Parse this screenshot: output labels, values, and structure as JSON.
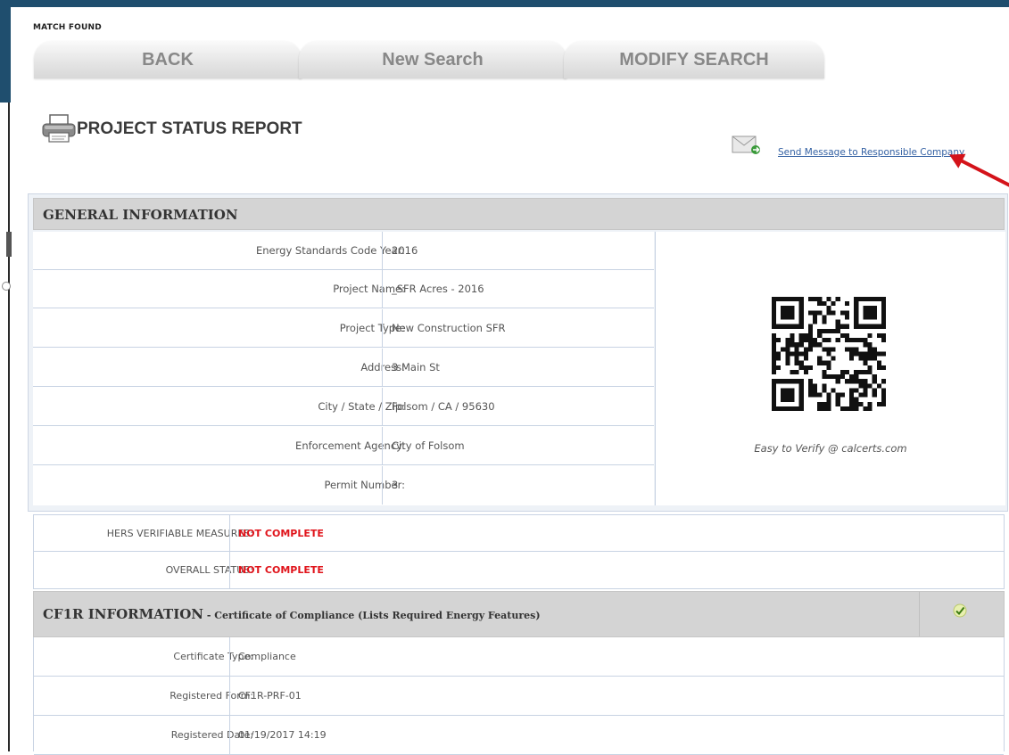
{
  "header": {
    "status_label": "MATCH FOUND"
  },
  "nav": {
    "back": "BACK",
    "new_search": "New Search",
    "modify_search": "MODIFY SEARCH"
  },
  "page": {
    "title": "PROJECT STATUS REPORT",
    "print_icon": "printer-icon"
  },
  "message_link": {
    "icon": "envelope-icon",
    "text": "Send Message to Responsible Company"
  },
  "general_info": {
    "heading": "GENERAL INFORMATION",
    "rows": [
      {
        "label": "Energy Standards Code Year:",
        "value": "2016"
      },
      {
        "label": "Project Name:",
        "value": "_SFR Acres - 2016"
      },
      {
        "label": "Project Type:",
        "value": "New Construction SFR"
      },
      {
        "label": "Address:",
        "value": "3 Main St"
      },
      {
        "label": "City / State / Zip:",
        "value": "Folsom / CA / 95630"
      },
      {
        "label": "Enforcement Agency:",
        "value": "City of Folsom"
      },
      {
        "label": "Permit Number:",
        "value": "3"
      }
    ],
    "qr_caption": "Easy to Verify @ calcerts.com"
  },
  "status": [
    {
      "label": "HERS VERIFIABLE MEASURES:",
      "value": "NOT COMPLETE"
    },
    {
      "label": "OVERALL STATUS:",
      "value": "NOT COMPLETE"
    }
  ],
  "cf1r": {
    "heading": "CF1R INFORMATION",
    "subheading": " - Certificate of Compliance (Lists Required Energy Features)",
    "check_icon": "checkmark-icon",
    "rows": [
      {
        "label": "Certificate Type:",
        "value": "Compliance"
      },
      {
        "label": "Registered Form:",
        "value": "CF1R-PRF-01"
      },
      {
        "label": "Registered Date:",
        "value": "01/19/2017 14:19"
      }
    ]
  },
  "colors": {
    "frame": "#1f4e6e",
    "alert": "#e0141b",
    "link": "#3461a3",
    "annotation_arrow": "#d4131a"
  }
}
